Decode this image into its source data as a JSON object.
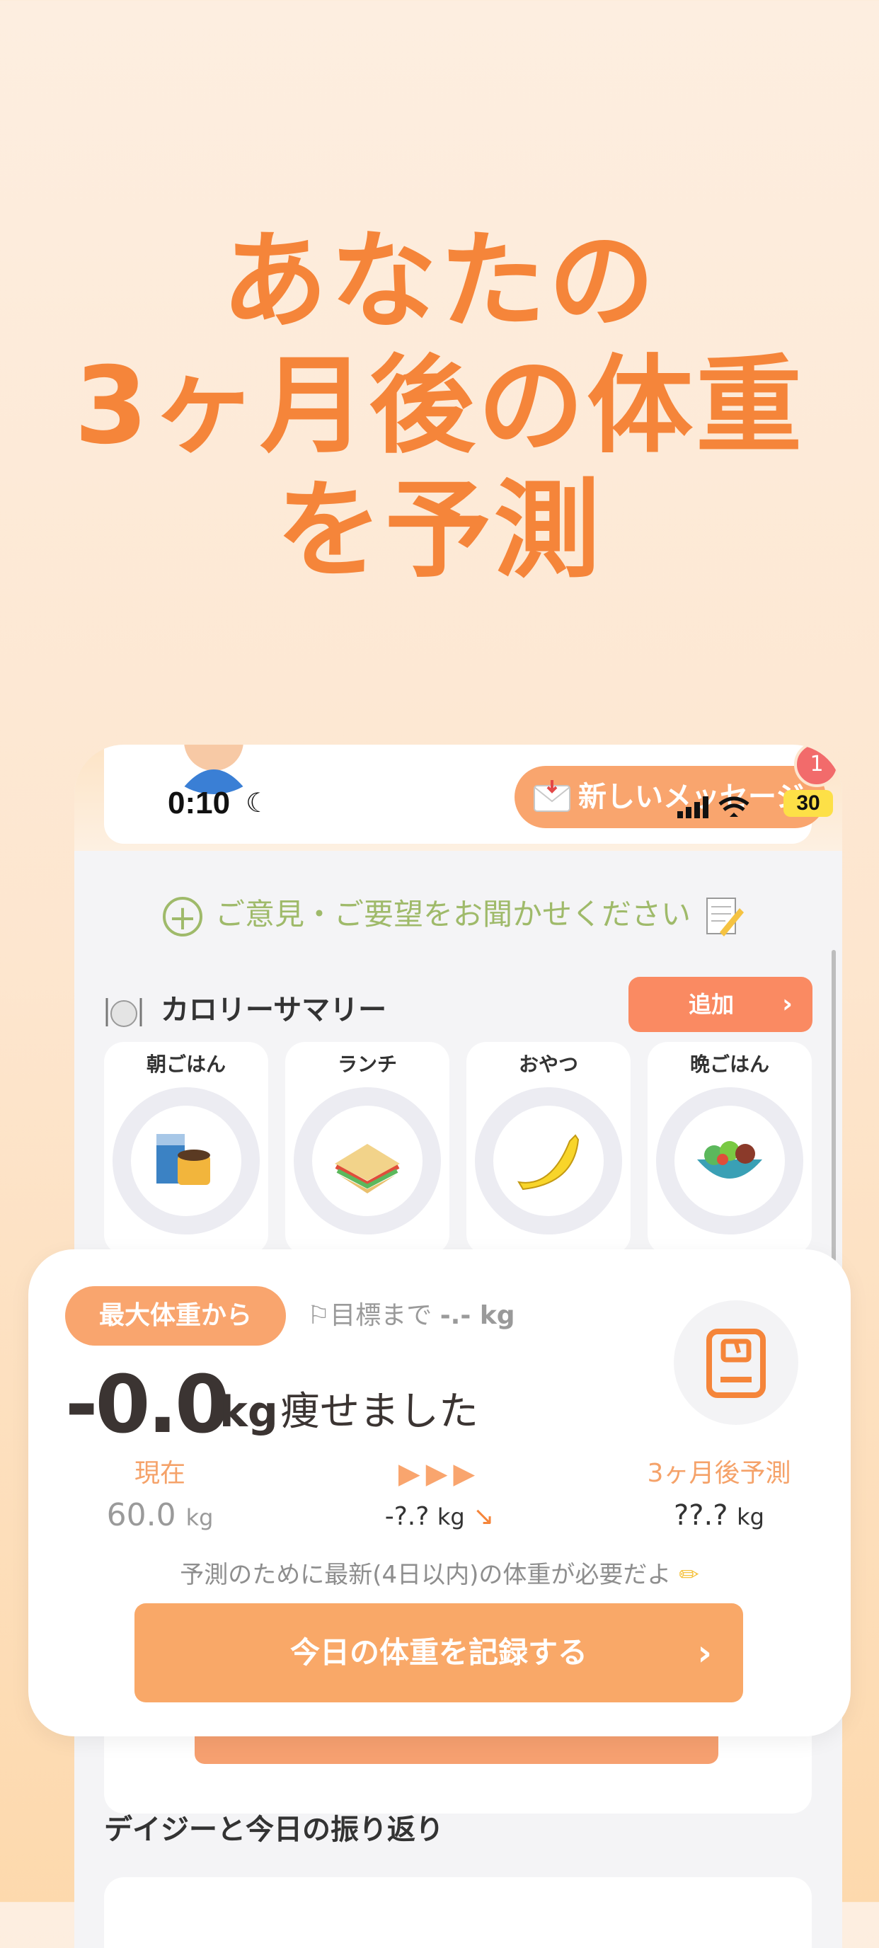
{
  "headline": {
    "line1": "あなたの",
    "line2": "3ヶ月後の体重",
    "line3": "を予測"
  },
  "status": {
    "time": "0:10",
    "battery": "30"
  },
  "header": {
    "message_button": "新しいメッセージ",
    "message_badge": "1"
  },
  "feedback": {
    "label": "ご意見・ご要望をお聞かせください"
  },
  "calorie": {
    "title": "カロリーサマリー",
    "add_label": "追加",
    "meals": [
      {
        "label": "朝ごはん",
        "icon": "coffee-bag-icon"
      },
      {
        "label": "ランチ",
        "icon": "sandwich-icon"
      },
      {
        "label": "おやつ",
        "icon": "banana-icon"
      },
      {
        "label": "晩ごはん",
        "icon": "salad-icon"
      }
    ]
  },
  "weight": {
    "tag": "最大体重から",
    "goal_label": "⚐目標まで",
    "goal_value": "-.- kg",
    "lost_value": "-0.0",
    "lost_unit": "kg",
    "lost_text": "痩せました",
    "current_label": "現在",
    "current_value": "60.0",
    "current_unit": "kg",
    "change_value": "-?.?",
    "change_unit": "kg",
    "forecast_label": "3ヶ月後予測",
    "forecast_value": "??.?",
    "forecast_unit": "kg",
    "note": "予測のために最新(4日以内)の体重が必要だよ",
    "record_button": "今日の体重を記録する"
  },
  "reflection": {
    "title": "デイジーと今日の振り返り"
  },
  "colors": {
    "accent": "#f5853a",
    "button": "#f9a868",
    "feedback_green": "#9fba6a"
  }
}
